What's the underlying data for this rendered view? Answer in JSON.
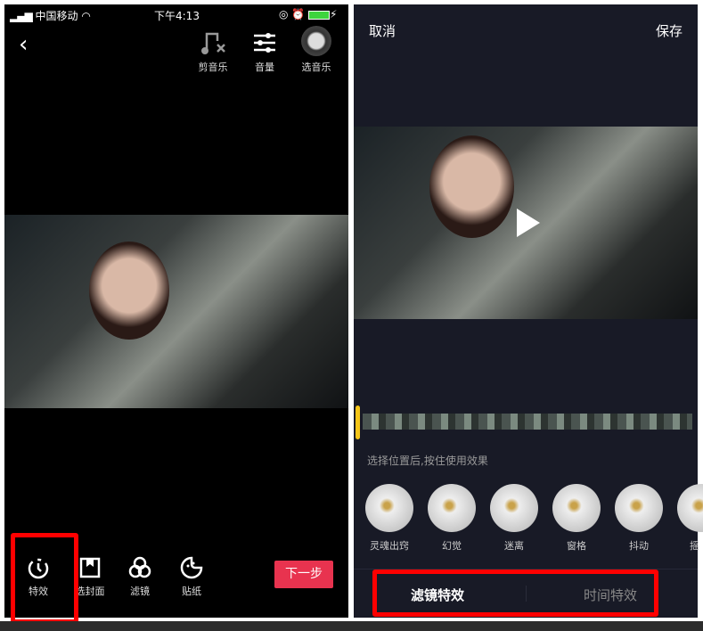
{
  "left": {
    "status": {
      "carrier": "中国移动",
      "time": "下午4:13"
    },
    "top_tools": [
      {
        "label": "剪音乐",
        "icon": "music-cut-icon"
      },
      {
        "label": "音量",
        "icon": "sliders-icon"
      },
      {
        "label": "选音乐",
        "icon": "music-disc-icon"
      }
    ],
    "bottom_tools": [
      {
        "label": "特效",
        "icon": "effects-timer-icon"
      },
      {
        "label": "选封面",
        "icon": "cover-icon"
      },
      {
        "label": "滤镜",
        "icon": "filter-icon"
      },
      {
        "label": "贴纸",
        "icon": "sticker-icon"
      }
    ],
    "next_button": "下一步",
    "accent": "#e8334f"
  },
  "right": {
    "cancel": "取消",
    "save": "保存",
    "hint": "选择位置后,按住使用效果",
    "effects": [
      "灵魂出窍",
      "幻觉",
      "迷离",
      "窗格",
      "抖动",
      "摇"
    ],
    "tabs": [
      {
        "label": "滤镜特效",
        "active": true
      },
      {
        "label": "时间特效",
        "active": false
      }
    ],
    "playhead_color": "#f5c518"
  },
  "highlight_color": "#ff0000"
}
